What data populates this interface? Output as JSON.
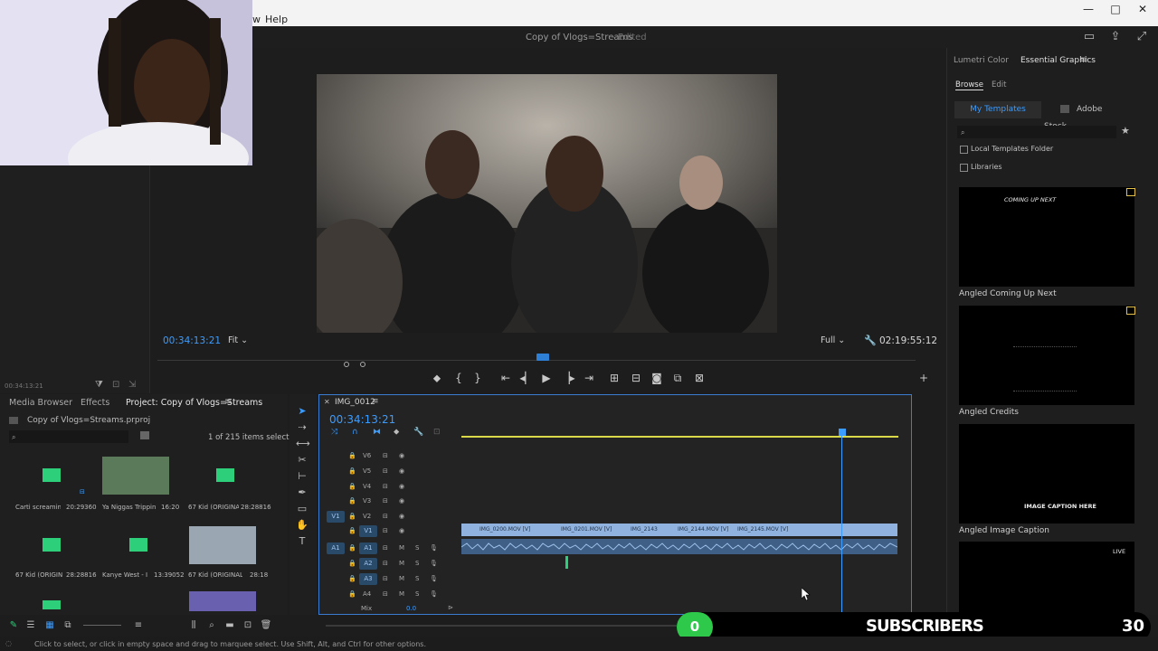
{
  "app": {
    "menu_partial": "w",
    "menu_help": "Help",
    "window_controls": [
      "—",
      "□",
      "✕"
    ],
    "title": "Copy of Vlogs=Streams",
    "title_status": "- Edited"
  },
  "program_monitor": {
    "timecode_left": "00:34:13:21",
    "fit": "Fit",
    "quality": "Full",
    "timecode_right": "02:19:55:12"
  },
  "left_panel": {
    "timecode": "00:34:13:21"
  },
  "essential_graphics": {
    "tabs": [
      "Lumetri Color",
      "Essential Graphics"
    ],
    "subtabs": [
      "Browse",
      "Edit"
    ],
    "my_templates": "My Templates",
    "adobe_stock": "Adobe Stock",
    "local_templates": "Local Templates Folder",
    "libraries": "Libraries",
    "templates": [
      {
        "label": "Angled Coming Up Next",
        "thumb_text": "COMING UP NEXT"
      },
      {
        "label": "Angled Credits",
        "thumb_text": ""
      },
      {
        "label": "Angled Image Caption",
        "thumb_text": "IMAGE CAPTION HERE"
      },
      {
        "label": "",
        "thumb_text": "LIVE"
      }
    ]
  },
  "project": {
    "tabs": [
      "Media Browser",
      "Effects",
      "Project: Copy of Vlogs=Streams"
    ],
    "path": "Copy of Vlogs=Streams.prproj",
    "count": "1 of 215 items selected",
    "clips": [
      {
        "name": "Carti screaming b...",
        "dur": "20:29360"
      },
      {
        "name": "Ya Niggas Trippin Rus...",
        "dur": "16:20"
      },
      {
        "name": "67 Kid (ORIGINAL...",
        "dur": "28:28816"
      },
      {
        "name": "67 Kid (ORIGINAL...",
        "dur": "28:28816"
      },
      {
        "name": "Kanye West - I G...",
        "dur": "13:39052"
      },
      {
        "name": "67 Kid (ORIGINAL) (L...",
        "dur": "28:18"
      }
    ]
  },
  "timeline": {
    "sequence": "IMG_0012",
    "timecode": "00:34:13:21",
    "video_tracks": [
      "V6",
      "V5",
      "V4",
      "V3",
      "V2",
      "V1"
    ],
    "audio_tracks": [
      "A1",
      "A2",
      "A3",
      "A4"
    ],
    "mix_label": "Mix",
    "mix_value": "0.0",
    "src_v": "V1",
    "src_a": "A1",
    "mute": "M",
    "solo": "S",
    "clips": [
      "IMG_0200.MOV [V]",
      "IMG_0201.MOV [V]",
      "IMG_2143",
      "IMG_2144.MOV [V]",
      "IMG_2145.MOV [V]"
    ]
  },
  "subscribers": {
    "count": "0",
    "label": "SUBSCRIBERS",
    "goal": "30"
  },
  "status": {
    "text": "Click to select, or click in empty space and drag to marquee select. Use Shift, Alt, and Ctrl for other options."
  }
}
